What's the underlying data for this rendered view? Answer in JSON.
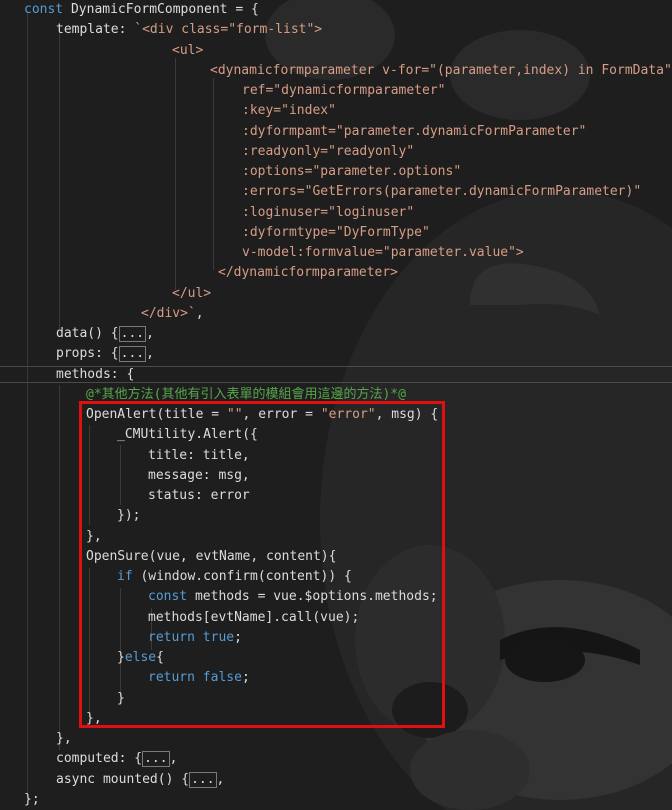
{
  "colors": {
    "background": "#1e1e1e",
    "default": "#dcdcdc",
    "keyword": "#569cd6",
    "string": "#d69d85",
    "comment": "#57a64a",
    "annotation_box": "#e01010"
  },
  "lines": [
    {
      "indent": 24,
      "segs": [
        [
          "keyword",
          "const"
        ],
        [
          "default",
          " DynamicFormComponent = {"
        ]
      ]
    },
    {
      "indent": 56,
      "segs": [
        [
          "default",
          "template: "
        ],
        [
          "string",
          "`<div class=\"form-list\">"
        ]
      ]
    },
    {
      "indent": 172,
      "segs": [
        [
          "string",
          "<ul>"
        ]
      ]
    },
    {
      "indent": 210,
      "segs": [
        [
          "string",
          "<dynamicformparameter v-for=\"(parameter,index) in FormData\""
        ]
      ]
    },
    {
      "indent": 242,
      "segs": [
        [
          "string",
          "ref=\"dynamicformparameter\""
        ]
      ]
    },
    {
      "indent": 242,
      "segs": [
        [
          "string",
          ":key=\"index\""
        ]
      ]
    },
    {
      "indent": 242,
      "segs": [
        [
          "string",
          ":dyformpamt=\"parameter.dynamicFormParameter\""
        ]
      ]
    },
    {
      "indent": 242,
      "segs": [
        [
          "string",
          ":readyonly=\"readyonly\""
        ]
      ]
    },
    {
      "indent": 242,
      "segs": [
        [
          "string",
          ":options=\"parameter.options\""
        ]
      ]
    },
    {
      "indent": 242,
      "segs": [
        [
          "string",
          ":errors=\"GetErrors(parameter.dynamicFormParameter)\""
        ]
      ]
    },
    {
      "indent": 242,
      "segs": [
        [
          "string",
          ":loginuser=\"loginuser\""
        ]
      ]
    },
    {
      "indent": 242,
      "segs": [
        [
          "string",
          ":dyformtype=\"DyFormType\""
        ]
      ]
    },
    {
      "indent": 242,
      "segs": [
        [
          "string",
          "v-model:formvalue=\"parameter.value\">"
        ]
      ]
    },
    {
      "indent": 218,
      "segs": [
        [
          "string",
          "</dynamicformparameter>"
        ]
      ]
    },
    {
      "indent": 172,
      "segs": [
        [
          "string",
          "</ul>"
        ]
      ]
    },
    {
      "indent": 141,
      "segs": [
        [
          "string",
          "</div>`"
        ],
        [
          "default",
          ","
        ]
      ]
    },
    {
      "indent": 56,
      "segs": [
        [
          "default",
          "data() {"
        ],
        [
          "fold",
          "..."
        ],
        [
          "default",
          ","
        ]
      ]
    },
    {
      "indent": 56,
      "segs": [
        [
          "default",
          "props: {"
        ],
        [
          "fold",
          "..."
        ],
        [
          "default",
          ","
        ]
      ]
    },
    {
      "indent": 56,
      "segs": [
        [
          "default",
          "methods: {"
        ]
      ]
    },
    {
      "indent": 86,
      "segs": [
        [
          "comment",
          "@*其他方法(其他有引入表單的模組會用這邊的方法)*@"
        ]
      ]
    },
    {
      "indent": 86,
      "segs": [
        [
          "default",
          "OpenAlert(title = "
        ],
        [
          "string",
          "\"\""
        ],
        [
          "default",
          ", error = "
        ],
        [
          "string",
          "\"error\""
        ],
        [
          "default",
          ", msg) {"
        ]
      ]
    },
    {
      "indent": 117,
      "segs": [
        [
          "default",
          "_CMUtility.Alert({"
        ]
      ]
    },
    {
      "indent": 148,
      "segs": [
        [
          "default",
          "title: title,"
        ]
      ]
    },
    {
      "indent": 148,
      "segs": [
        [
          "default",
          "message: msg,"
        ]
      ]
    },
    {
      "indent": 148,
      "segs": [
        [
          "default",
          "status: error"
        ]
      ]
    },
    {
      "indent": 117,
      "segs": [
        [
          "default",
          "});"
        ]
      ]
    },
    {
      "indent": 86,
      "segs": [
        [
          "default",
          "},"
        ]
      ]
    },
    {
      "indent": 86,
      "segs": [
        [
          "default",
          "OpenSure(vue, evtName, content){"
        ]
      ]
    },
    {
      "indent": 117,
      "segs": [
        [
          "keyword",
          "if"
        ],
        [
          "default",
          " (window.confirm(content)) {"
        ]
      ]
    },
    {
      "indent": 148,
      "segs": [
        [
          "keyword",
          "const"
        ],
        [
          "default",
          " methods = vue.$options.methods;"
        ]
      ]
    },
    {
      "indent": 148,
      "segs": [
        [
          "default",
          "methods[evtName].call(vue);"
        ]
      ]
    },
    {
      "indent": 148,
      "segs": [
        [
          "keyword",
          "return"
        ],
        [
          "default",
          " "
        ],
        [
          "keyword",
          "true"
        ],
        [
          "default",
          ";"
        ]
      ]
    },
    {
      "indent": 117,
      "segs": [
        [
          "default",
          "}"
        ],
        [
          "keyword",
          "else"
        ],
        [
          "default",
          "{"
        ]
      ]
    },
    {
      "indent": 148,
      "segs": [
        [
          "keyword",
          "return"
        ],
        [
          "default",
          " "
        ],
        [
          "keyword",
          "false"
        ],
        [
          "default",
          ";"
        ]
      ]
    },
    {
      "indent": 117,
      "segs": [
        [
          "default",
          "}"
        ]
      ]
    },
    {
      "indent": 86,
      "segs": [
        [
          "default",
          "},"
        ]
      ]
    },
    {
      "indent": 56,
      "segs": [
        [
          "default",
          "},"
        ]
      ]
    },
    {
      "indent": 56,
      "segs": [
        [
          "default",
          "computed: {"
        ],
        [
          "fold",
          "..."
        ],
        [
          "default",
          ","
        ]
      ]
    },
    {
      "indent": 56,
      "segs": [
        [
          "default",
          "async mounted() {"
        ],
        [
          "fold",
          "..."
        ],
        [
          "default",
          ","
        ]
      ]
    },
    {
      "indent": 24,
      "segs": [
        [
          "default",
          "};"
        ]
      ]
    }
  ]
}
